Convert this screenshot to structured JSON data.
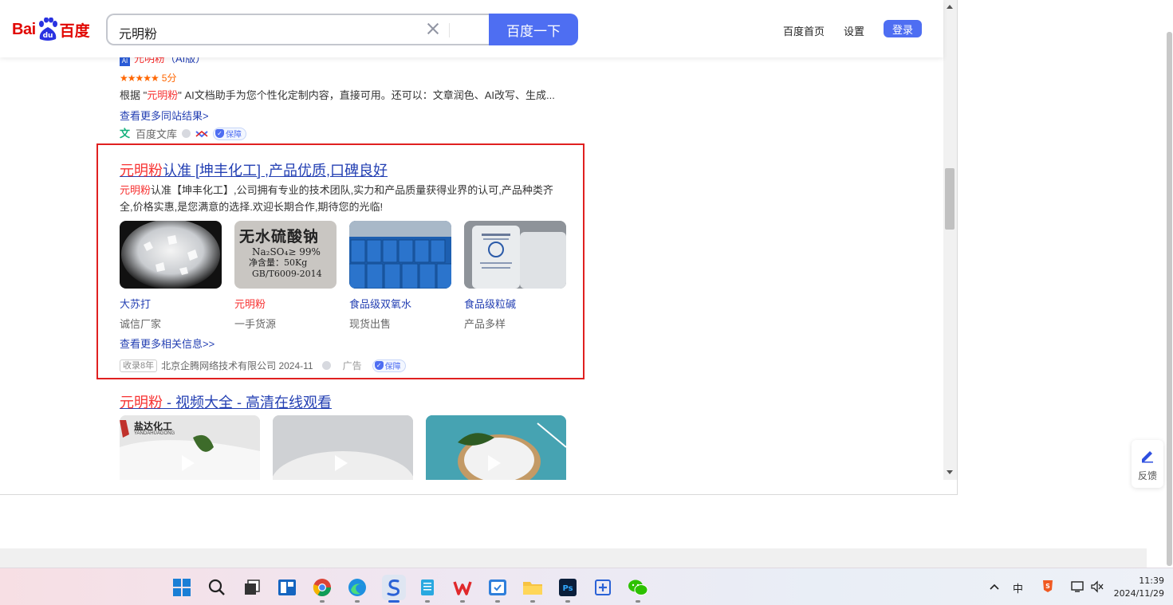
{
  "header": {
    "logo_bai": "Bai",
    "logo_du": "du",
    "logo_cn": "百度",
    "query": "元明粉",
    "search_button": "百度一下",
    "links": {
      "home": "百度首页",
      "settings": "设置"
    },
    "login": "登录"
  },
  "result1": {
    "title_cut_hl": "元明粉",
    "title_cut_rest": "（AI版）",
    "ai_badge": "AI",
    "stars": "★★★★★",
    "score": "5分",
    "desc_prefix": "根据 \"",
    "desc_hl": "元明粉",
    "desc_suffix": "\" AI文档助手为您个性化定制内容，直接可用。还可以：文章润色、AI改写、生成...",
    "more": "查看更多同站结果>",
    "source": "百度文库",
    "bao": "保障"
  },
  "ad": {
    "title_hl": "元明粉",
    "title_rest": "认准 [坤丰化工] ,产品优质,口碑良好",
    "desc_hl": "元明粉",
    "desc_rest": "认准【坤丰化工】,公司拥有专业的技术团队,实力和产品质量获得业界的认可,产品种类齐全,价格实惠,是您满意的选择.欢迎长期合作,期待您的光临!",
    "products": [
      {
        "name": "大苏打",
        "sub": "诚信厂家",
        "red": false
      },
      {
        "name": "元明粉",
        "sub": "一手货源",
        "red": true
      },
      {
        "name": "食品级双氧水",
        "sub": "现货出售",
        "red": false
      },
      {
        "name": "食品级粒碱",
        "sub": "产品多样",
        "red": false
      }
    ],
    "bag_text": {
      "l1": "无水硫酸钠",
      "l2": "Na₂SO₄≥ 99%",
      "l3": "净含量：50Kg",
      "l4": "GB/T6009-2014"
    },
    "more": "查看更多相关信息>>",
    "tag": "收录8年",
    "company": "北京企腾网络技术有限公司 2024-11",
    "ad_label": "广告",
    "bao": "保障"
  },
  "video": {
    "title_hl": "元明粉",
    "title_rest": " - 视频大全 - 高清在线观看",
    "thumb1_brand": "盐达化工",
    "thumb1_brand_en": "YANDAHUAGONG"
  },
  "feedback": "反馈",
  "tray": {
    "ime": "中",
    "date": "2024/11/29",
    "time": "11:39"
  },
  "colors": {
    "brand_blue": "#4e6ef2",
    "link_blue": "#2440b3",
    "highlight_red": "#f73131",
    "ad_border": "#e02020"
  }
}
